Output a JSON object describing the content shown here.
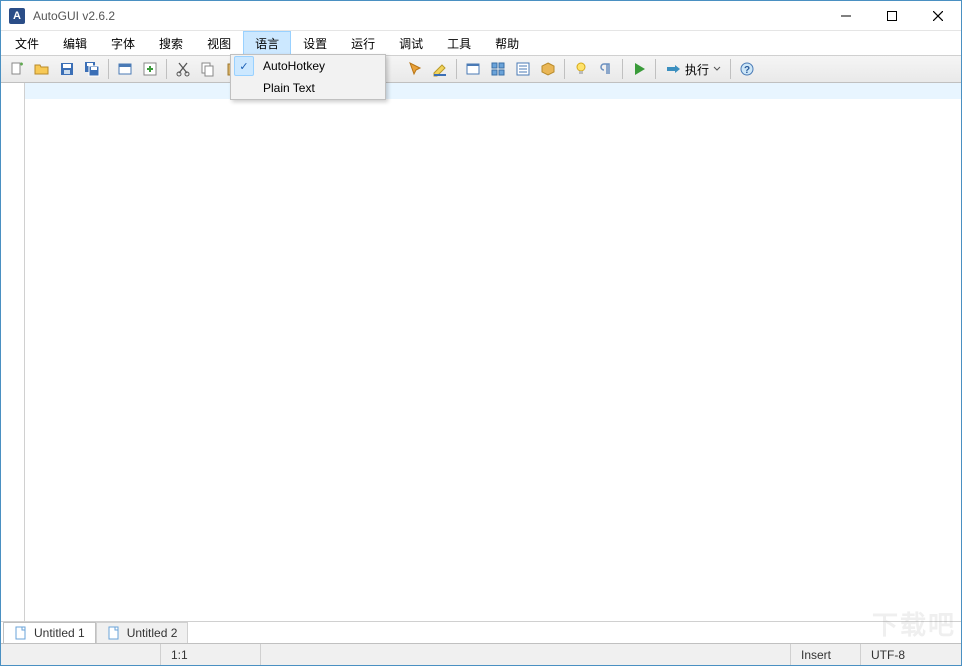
{
  "window": {
    "title": "AutoGUI v2.6.2",
    "app_icon_letter": "A"
  },
  "menubar": {
    "items": [
      "文件",
      "编辑",
      "字体",
      "搜索",
      "视图",
      "语言",
      "设置",
      "运行",
      "调试",
      "工具",
      "帮助"
    ],
    "open_index": 5
  },
  "dropdown": {
    "items": [
      {
        "label": "AutoHotkey",
        "checked": true
      },
      {
        "label": "Plain Text",
        "checked": false
      }
    ]
  },
  "toolbar": {
    "run_label": "执行"
  },
  "tabs": {
    "items": [
      {
        "label": "Untitled 1",
        "active": true
      },
      {
        "label": "Untitled 2",
        "active": false
      }
    ]
  },
  "statusbar": {
    "position": "1:1",
    "insert_mode": "Insert",
    "encoding": "UTF-8"
  },
  "watermark": "下载吧"
}
